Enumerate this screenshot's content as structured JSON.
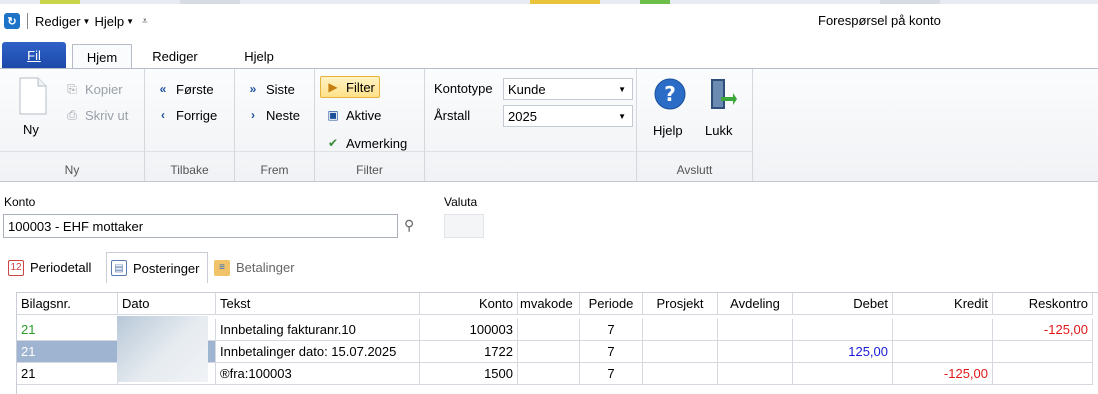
{
  "quick_access": {
    "menu1": "Rediger",
    "menu2": "Hjelp"
  },
  "window_title": "Forespørsel på konto",
  "tabs": {
    "fil": "Fil",
    "hjem": "Hjem",
    "rediger": "Rediger",
    "hjelp": "Hjelp"
  },
  "ribbon": {
    "ny": {
      "button": "Ny",
      "kopier": "Kopier",
      "skrivut": "Skriv ut",
      "label": "Ny"
    },
    "tilbake": {
      "forste": "Første",
      "forrige": "Forrige",
      "label": "Tilbake"
    },
    "frem": {
      "siste": "Siste",
      "neste": "Neste",
      "label": "Frem"
    },
    "filter": {
      "filter": "Filter",
      "aktive": "Aktive",
      "avmerking": "Avmerking",
      "label": "Filter"
    },
    "kontotype_label": "Kontotype",
    "kontotype_value": "Kunde",
    "arstall_label": "Årstall",
    "arstall_value": "2025",
    "avslutt": {
      "hjelp": "Hjelp",
      "lukk": "Lukk",
      "label": "Avslutt"
    }
  },
  "konto": {
    "label": "Konto",
    "value": "100003 - EHF mottaker",
    "valuta_label": "Valuta"
  },
  "subtabs": [
    "Periodetall",
    "Posteringer",
    "Betalinger"
  ],
  "table": {
    "columns": [
      "Bilagsnr.",
      "Dato",
      "Tekst",
      "Konto",
      "mvakode",
      "Periode",
      "Prosjekt",
      "Avdeling",
      "Debet",
      "Kredit",
      "Reskontro"
    ],
    "rows": [
      {
        "bilagsnr": "21",
        "dato": "",
        "tekst": "Innbetaling fakturanr.10",
        "konto": "100003",
        "mvakode": "",
        "periode": "7",
        "prosjekt": "",
        "avdeling": "",
        "debet": "",
        "kredit": "",
        "reskontro": "-125,00"
      },
      {
        "bilagsnr": "21",
        "dato": "",
        "tekst": "Innbetalinger dato: 15.07.2025",
        "konto": "1722",
        "mvakode": "",
        "periode": "7",
        "prosjekt": "",
        "avdeling": "",
        "debet": "125,00",
        "kredit": "",
        "reskontro": ""
      },
      {
        "bilagsnr": "21",
        "dato": "",
        "tekst": "®fra:100003",
        "konto": "1500",
        "mvakode": "",
        "periode": "7",
        "prosjekt": "",
        "avdeling": "",
        "debet": "",
        "kredit": "-125,00",
        "reskontro": ""
      }
    ]
  },
  "colors": {
    "fil_tab": "#2a5bc0",
    "credit_red": "#e01818",
    "debit_blue": "#1b1bd6",
    "green_text": "#2a9c2a",
    "selection": "#9fb4d0"
  }
}
